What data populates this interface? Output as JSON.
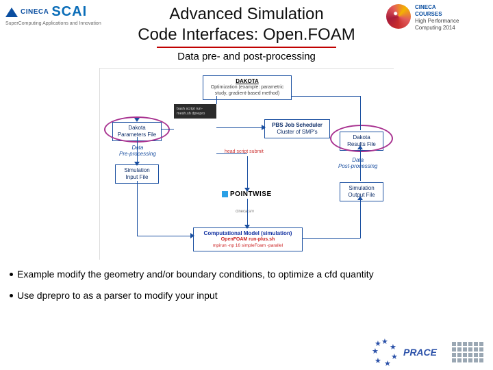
{
  "header": {
    "left_logo": {
      "brand1": "CINECA",
      "brand2": "SCAI",
      "tagline": "SuperComputing Applications and Innovation"
    },
    "right_logo": {
      "line1": "CINECA",
      "line2": "COURSES",
      "line3": "High Performance",
      "line4": "Computing 2014"
    },
    "title_line1": "Advanced Simulation",
    "title_line2": "Code Interfaces: Open.FOAM"
  },
  "subtitle": "Data pre- and post-processing",
  "diagram": {
    "dakota": {
      "title": "DAKOTA",
      "sub": "Optimization (example: parametric study, gradient-based method)"
    },
    "params": {
      "title": "Dakota",
      "sub": "Parameters File"
    },
    "pbs": {
      "title": "PBS Job Scheduler",
      "sub": "Cluster of SMP's"
    },
    "results": {
      "title": "Dakota",
      "sub": "Results File"
    },
    "siminput": {
      "title": "Simulation",
      "sub": "Input File"
    },
    "simoutput": {
      "title": "Simulation",
      "sub": "Output File"
    },
    "model": {
      "title": "Computational Model (simulation)",
      "line2": "OpenFOAM run-plus.sh",
      "line3": "mpirun -np 16 simpleFoam -parallel"
    },
    "label_prepro": "Data\nPre-processing",
    "label_postpro": "Data\nPost-processing",
    "pointwise": "POINTWISE",
    "grey_snippet": "bash script\nrun-mesh.sh\ndprepro",
    "head_script": "head script submit",
    "cineca_addr": "cineca.srv"
  },
  "bullets": {
    "b1": "Example modify the geometry and/or  boundary conditions,  to optimize a cfd quantity",
    "b2": "Use dprepro to as a parser to modify your input"
  },
  "footer": {
    "prace": "PRACE"
  }
}
